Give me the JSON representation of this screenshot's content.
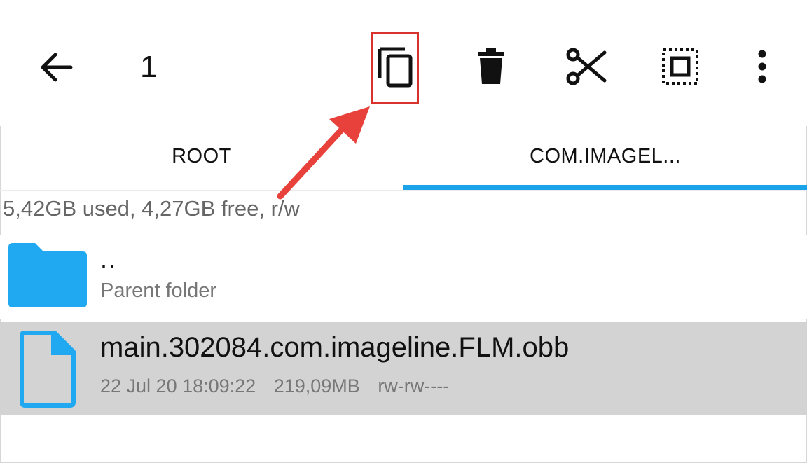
{
  "toolbar": {
    "selection_count": "1",
    "icons": {
      "back": "arrow-back-icon",
      "copy": "copy-icon",
      "delete": "delete-icon",
      "cut": "cut-icon",
      "select_all": "select-all-icon",
      "more": "more-vert-icon"
    }
  },
  "tabs": [
    {
      "label": "ROOT",
      "active": false
    },
    {
      "label": "COM.IMAGEL...",
      "active": true
    }
  ],
  "storage_info": "5,42GB used, 4,27GB free, r/w",
  "files": {
    "parent": {
      "name": "..",
      "description": "Parent folder",
      "icon": "folder-icon"
    },
    "items": [
      {
        "name": "main.302084.com.imageline.FLM.obb",
        "date": "22 Jul 20 18:09:22",
        "size": "219,09MB",
        "permissions": "rw-rw----",
        "icon": "file-icon",
        "selected": true
      }
    ]
  },
  "colors": {
    "accent": "#1aa3e8",
    "highlight": "#d9322e",
    "selected_row": "#d3d3d3",
    "icon_blue": "#20a8f0"
  }
}
